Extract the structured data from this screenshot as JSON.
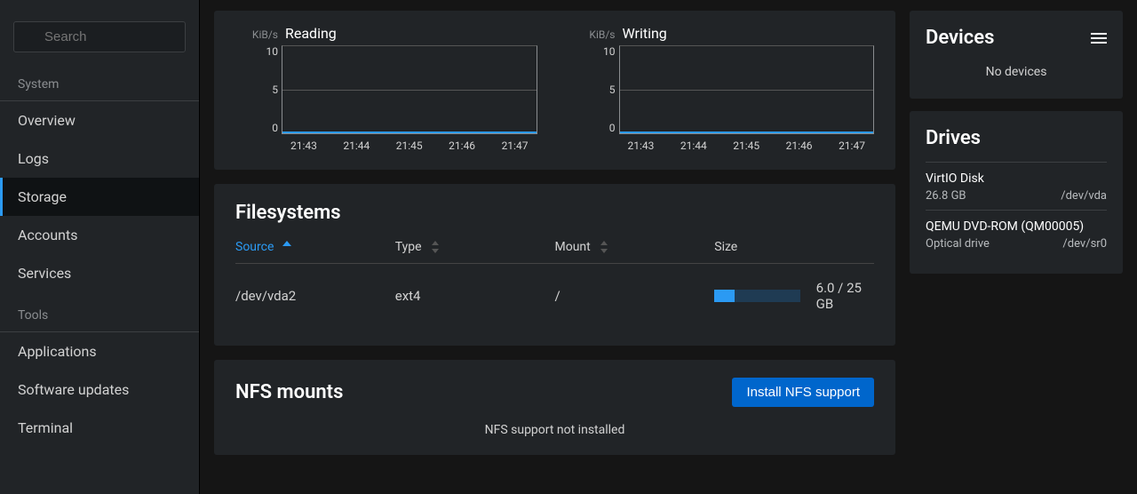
{
  "search": {
    "placeholder": "Search"
  },
  "sidebar": {
    "group1_title": "System",
    "group2_title": "Tools",
    "system_items": [
      {
        "label": "Overview"
      },
      {
        "label": "Logs"
      },
      {
        "label": "Storage"
      },
      {
        "label": "Accounts"
      },
      {
        "label": "Services"
      }
    ],
    "tools_items": [
      {
        "label": "Applications"
      },
      {
        "label": "Software updates"
      },
      {
        "label": "Terminal"
      }
    ]
  },
  "charts": {
    "reading": {
      "unit": "KiB/s",
      "title": "Reading"
    },
    "writing": {
      "unit": "KiB/s",
      "title": "Writing"
    },
    "y_ticks": [
      "10",
      "5",
      "0"
    ],
    "x_ticks": [
      "21:43",
      "21:44",
      "21:45",
      "21:46",
      "21:47"
    ]
  },
  "chart_data": [
    {
      "type": "line",
      "title": "Reading",
      "ylabel": "KiB/s",
      "ylim": [
        0,
        10
      ],
      "x": [
        "21:43",
        "21:44",
        "21:45",
        "21:46",
        "21:47"
      ],
      "series": [
        {
          "name": "Reading",
          "values": [
            0,
            0,
            0,
            0,
            0
          ]
        }
      ]
    },
    {
      "type": "line",
      "title": "Writing",
      "ylabel": "KiB/s",
      "ylim": [
        0,
        10
      ],
      "x": [
        "21:43",
        "21:44",
        "21:45",
        "21:46",
        "21:47"
      ],
      "series": [
        {
          "name": "Writing",
          "values": [
            0,
            0,
            0,
            0,
            0
          ]
        }
      ]
    }
  ],
  "filesystems": {
    "title": "Filesystems",
    "columns": {
      "source": "Source",
      "type": "Type",
      "mount": "Mount",
      "size": "Size"
    },
    "rows": [
      {
        "source": "/dev/vda2",
        "type": "ext4",
        "mount": "/",
        "used": 6.0,
        "total": 25,
        "size_text": "6.0 / 25 GB",
        "pct": 24
      }
    ]
  },
  "nfs": {
    "title": "NFS mounts",
    "button": "Install NFS support",
    "empty": "NFS support not installed"
  },
  "devices": {
    "title": "Devices",
    "empty": "No devices"
  },
  "drives": {
    "title": "Drives",
    "items": [
      {
        "name": "VirtIO Disk",
        "sub": "26.8 GB",
        "path": "/dev/vda"
      },
      {
        "name": "QEMU DVD-ROM (QM00005)",
        "sub": "Optical drive",
        "path": "/dev/sr0"
      }
    ]
  }
}
